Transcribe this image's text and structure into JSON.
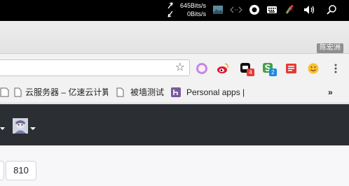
{
  "menubar": {
    "upload_speed": "645Bits/s",
    "download_speed": "0Bits/s",
    "icons": [
      "up-arrow-icon",
      "down-arrow-icon",
      "landscape-icon",
      "code-arrows-icon",
      "record-icon",
      "keyboard-icon",
      "color-picker-icon",
      "speaker-icon",
      "search-icon"
    ]
  },
  "titlebar": {
    "user_name": "陈宏洲"
  },
  "toolbar": {
    "extensions": [
      {
        "icon": "circle-ext-icon"
      },
      {
        "icon": "weibo-icon"
      },
      {
        "icon": "dark-ext-icon",
        "badge": "4",
        "badge_color": "#e53935"
      },
      {
        "icon": "s-ext-icon",
        "badge": "2",
        "badge_color": "#1e88e5"
      },
      {
        "icon": "note-ext-icon"
      },
      {
        "icon": "smiley-icon"
      },
      {
        "icon": "menu-icon"
      }
    ]
  },
  "bookmarks": {
    "items": [
      {
        "label": "云服务器 – 亿速云计算",
        "icon": "page-icon"
      },
      {
        "label": "被墙测试",
        "icon": "page-icon"
      },
      {
        "label": "Personal apps | Heroku",
        "icon": "heroku-icon"
      }
    ],
    "overflow": "»"
  },
  "content": {
    "number": "810"
  },
  "colors": {
    "nav_bg": "#2b2f33",
    "heroku_purple": "#79589f"
  }
}
